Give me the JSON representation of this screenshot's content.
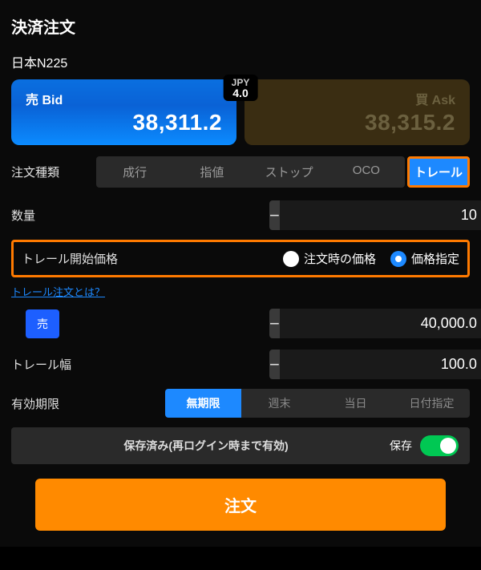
{
  "title": "決済注文",
  "symbol": "日本N225",
  "bid": {
    "label": "売 Bid",
    "price": "38,311.2"
  },
  "ask": {
    "label": "買 Ask",
    "price": "38,315.2"
  },
  "spread": {
    "ccy": "JPY",
    "value": "4.0"
  },
  "labels": {
    "order_type": "注文種類",
    "qty": "数量",
    "trail_start": "トレール開始価格",
    "trail_width": "トレール幅",
    "expiry": "有効期限",
    "help": "トレール注文とは？",
    "sell": "売",
    "saved": "保存済み(再ログイン時まで有効)",
    "save": "保存",
    "submit": "注文"
  },
  "order_types": [
    "成行",
    "指値",
    "ストップ",
    "OCO",
    "トレール"
  ],
  "order_type_selected": 4,
  "qty": "10",
  "trail_start_options": [
    "注文時の価格",
    "価格指定"
  ],
  "trail_start_selected": 1,
  "trail_price": "40,000.0",
  "trail_width": "100.0",
  "expiry_options": [
    "無期限",
    "週末",
    "当日",
    "日付指定"
  ],
  "expiry_selected": 0,
  "save_on": true
}
